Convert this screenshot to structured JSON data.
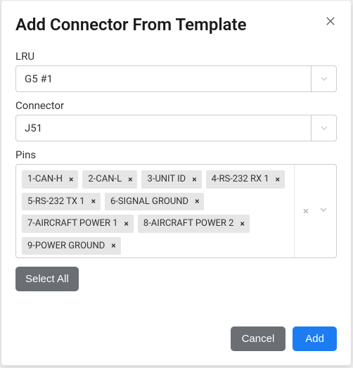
{
  "modal_title": "Add Connector From Template",
  "fields": {
    "lru": {
      "label": "LRU",
      "value": "G5 #1"
    },
    "connector": {
      "label": "Connector",
      "value": "J51"
    },
    "pins": {
      "label": "Pins",
      "tags": [
        "1-CAN-H",
        "2-CAN-L",
        "3-UNIT ID",
        "4-RS-232 RX 1",
        "5-RS-232 TX 1",
        "6-SIGNAL GROUND",
        "7-AIRCRAFT POWER 1",
        "8-AIRCRAFT POWER 2",
        "9-POWER GROUND"
      ]
    }
  },
  "buttons": {
    "select_all": "Select All",
    "cancel": "Cancel",
    "add": "Add"
  },
  "glyphs": {
    "tag_remove": "×",
    "clear_all": "×"
  }
}
